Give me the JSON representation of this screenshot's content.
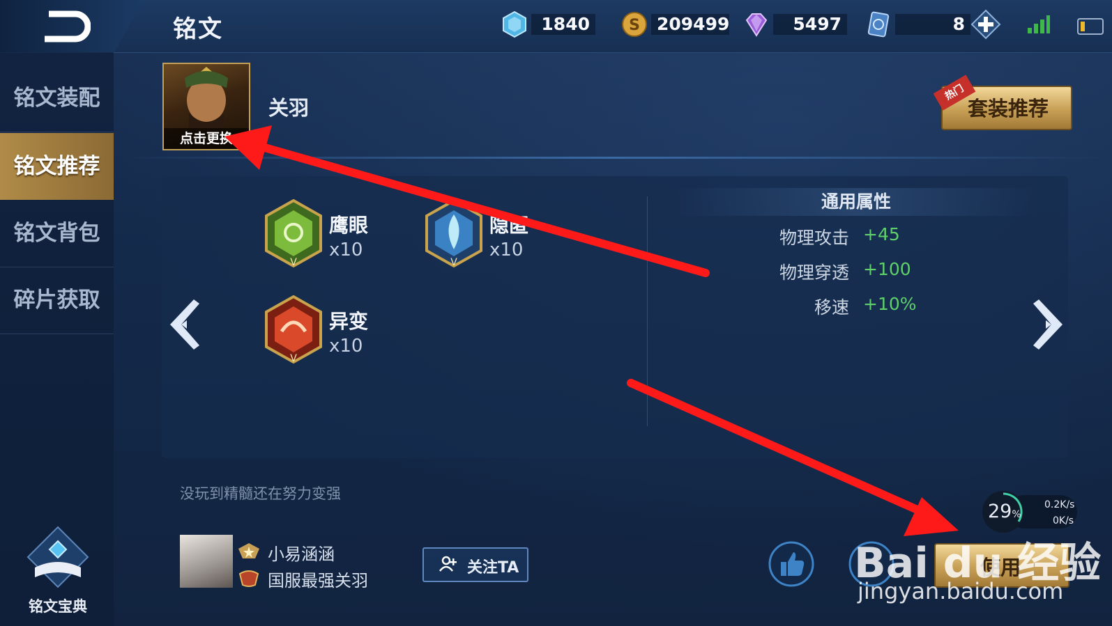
{
  "header": {
    "title": "铭文",
    "resources": [
      {
        "icon": "blue-crystal-icon",
        "value": "1840"
      },
      {
        "icon": "gold-coin-icon",
        "value": "209499"
      },
      {
        "icon": "purple-diamond-icon",
        "value": "5497"
      },
      {
        "icon": "ticket-card-icon",
        "value": "8"
      }
    ]
  },
  "sidebar": {
    "items": [
      {
        "label": "铭文装配"
      },
      {
        "label": "铭文推荐"
      },
      {
        "label": "铭文背包"
      },
      {
        "label": "碎片获取"
      }
    ],
    "codex_label": "铭文宝典"
  },
  "hero": {
    "change_caption": "点击更换",
    "name": "关羽",
    "recommend_label": "套装推荐",
    "hot_tag": "热门"
  },
  "runes": [
    {
      "name": "鹰眼",
      "count": "x10",
      "color": "#5a8a2e"
    },
    {
      "name": "隐匿",
      "count": "x10",
      "color": "#2f6fa8"
    },
    {
      "name": "异变",
      "count": "x10",
      "color": "#b8321e"
    }
  ],
  "attributes": {
    "title": "通用属性",
    "rows": [
      {
        "key": "物理攻击",
        "value": "+45"
      },
      {
        "key": "物理穿透",
        "value": "+100"
      },
      {
        "key": "移速",
        "value": "+10%"
      }
    ]
  },
  "author": {
    "note": "没玩到精髓还在努力变强",
    "name": "小易涵涵",
    "title": "国服最强关羽",
    "follow_label": "关注TA"
  },
  "actions": {
    "use_label": "使用"
  },
  "netmon": {
    "percent": "29",
    "percent_unit": "%",
    "up": "0.2K/s",
    "down": "0K/s"
  },
  "watermark": {
    "brand": "Bai du 经验",
    "url": "jingyan.baidu.com"
  },
  "colors": {
    "accent_gold": "#c79f55",
    "attr_green": "#5fd06a",
    "annotation_red": "#ff1a1a"
  }
}
